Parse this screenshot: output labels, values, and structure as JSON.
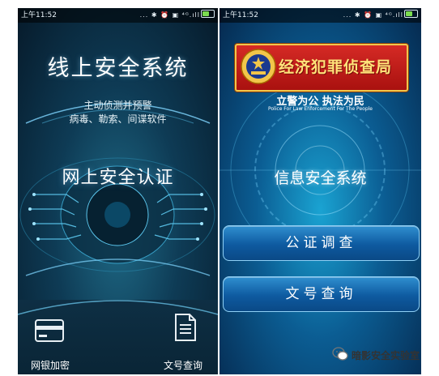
{
  "left": {
    "status": {
      "time": "上午11:52",
      "icons": "... ✱ ⏰ ▣ ⁴ᴳ.ıll"
    },
    "title": "线上安全系统",
    "subtitle_line1": "主动侦测并预警",
    "subtitle_line2": "病毒、勒索、间谍软件",
    "certification": "网上安全认证",
    "bottom": {
      "left_label": "网银加密",
      "left_icon": "card-icon",
      "right_label": "文号查询",
      "right_icon": "document-icon"
    }
  },
  "right": {
    "status": {
      "time": "上午11:52",
      "icons": "... ✱ ⏰ ▣ ⁴ᴳ.ıll"
    },
    "badge_text": "经济犯罪侦查局",
    "slogan": "立警为公 执法为民",
    "slogan_en": "Police For Law Enforcement For The People",
    "system_title": "信息安全系统",
    "button1": "公证调查",
    "button2": "文号查询"
  },
  "watermark": {
    "text": "暗影安全实验室",
    "icon": "wechat-icon"
  },
  "colors": {
    "badge_red": "#c51c18",
    "badge_gold": "#f2c64a",
    "button_blue": "#0e5aa0",
    "battery_green": "#7bdc4f"
  }
}
